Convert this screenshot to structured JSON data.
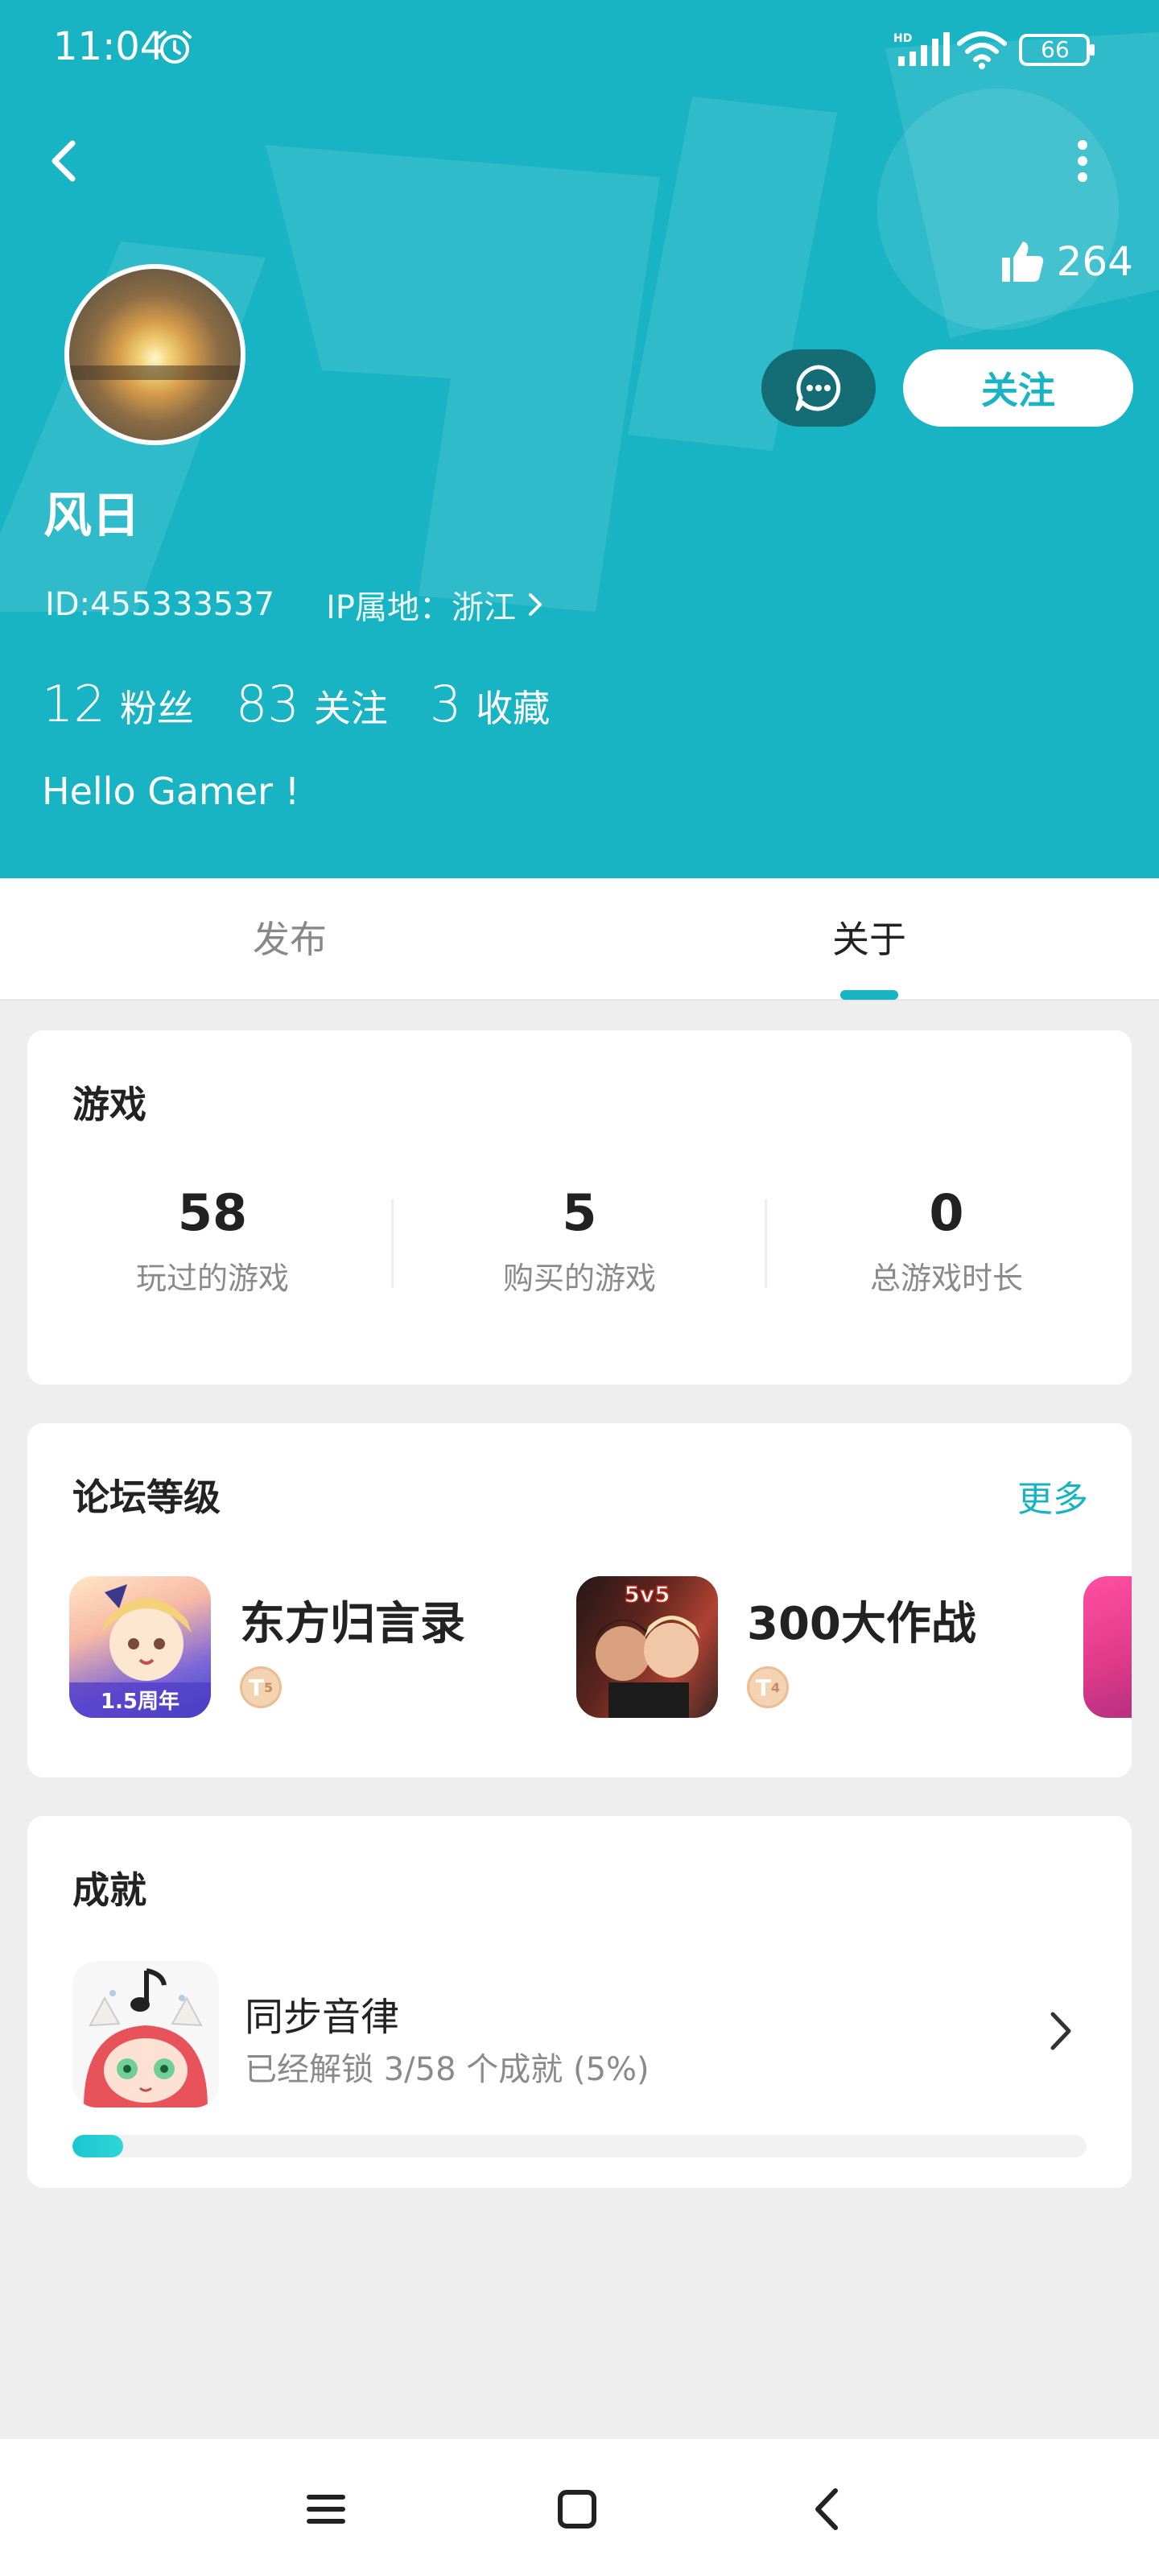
{
  "status_bar": {
    "time": "11:04",
    "battery": "66"
  },
  "profile": {
    "likes": "264",
    "name": "风日",
    "id_text": "ID:455333537",
    "ip_text": "IP属地：浙江",
    "follow_label": "关注",
    "stats": [
      {
        "num": "12",
        "label": "粉丝"
      },
      {
        "num": "83",
        "label": "关注"
      },
      {
        "num": "3",
        "label": "收藏"
      }
    ],
    "bio": "Hello Gamer !"
  },
  "tabs": {
    "publish": "发布",
    "about": "关于"
  },
  "games": {
    "title": "游戏",
    "stats": [
      {
        "num": "58",
        "label": "玩过的游戏"
      },
      {
        "num": "5",
        "label": "购买的游戏"
      },
      {
        "num": "0",
        "label": "总游戏时长"
      }
    ]
  },
  "forum": {
    "title": "论坛等级",
    "more": "更多",
    "items": [
      {
        "name": "东方归言录",
        "icon_text": "1.5周年",
        "level": "5"
      },
      {
        "name": "300大作战",
        "icon_text": "5v5",
        "level": "4"
      }
    ]
  },
  "achievements": {
    "title": "成就",
    "item_name": "同步音律",
    "item_desc": "已经解锁 3/58 个成就 (5%)",
    "progress_percent": 5
  },
  "colors": {
    "accent": "#19b4c4",
    "background": "#eeeeee"
  }
}
